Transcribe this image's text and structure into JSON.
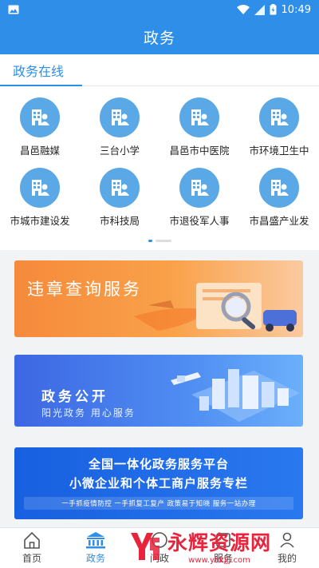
{
  "status_bar": {
    "time": "10:49",
    "icons": [
      "image-icon",
      "wifi-icon",
      "signal-icon",
      "battery-icon"
    ]
  },
  "header": {
    "title": "政务"
  },
  "section": {
    "title": "政务在线",
    "items": [
      {
        "label": "昌邑融媒",
        "icon": "government-office-icon"
      },
      {
        "label": "三台小学",
        "icon": "government-office-icon"
      },
      {
        "label": "昌邑市中医院",
        "icon": "government-office-icon"
      },
      {
        "label": "市环境卫生中",
        "icon": "government-office-icon"
      },
      {
        "label": "市城市建设发",
        "icon": "government-office-icon"
      },
      {
        "label": "市科技局",
        "icon": "government-office-icon"
      },
      {
        "label": "市退役军人事",
        "icon": "government-office-icon"
      },
      {
        "label": "市昌盛产业发",
        "icon": "government-office-icon"
      }
    ]
  },
  "banners": {
    "b1": {
      "title": "违章查询服务"
    },
    "b2": {
      "title": "政务公开",
      "subtitle": "阳光政务  用心服务"
    },
    "b3": {
      "line1": "全国一体化政务服务平台",
      "line2": "小微企业和个体工商户服务专栏",
      "strip": "一手抓疫情防控  一手抓复工复产  政策易于知晓  服务一站办理"
    }
  },
  "tabbar": {
    "tabs": [
      {
        "label": "首页",
        "icon": "home-icon"
      },
      {
        "label": "政务",
        "icon": "government-building-icon"
      },
      {
        "label": "问政",
        "icon": "question-icon"
      },
      {
        "label": "服务",
        "icon": "service-icon"
      },
      {
        "label": "我的",
        "icon": "user-icon"
      }
    ],
    "active_index": 1
  },
  "watermark": {
    "brand": "永辉资源网",
    "url": "www.yhkjjj.com"
  },
  "colors": {
    "primary": "#2e8ee8",
    "icon_circle": "#5aa8e6",
    "watermark": "#e8233c"
  }
}
